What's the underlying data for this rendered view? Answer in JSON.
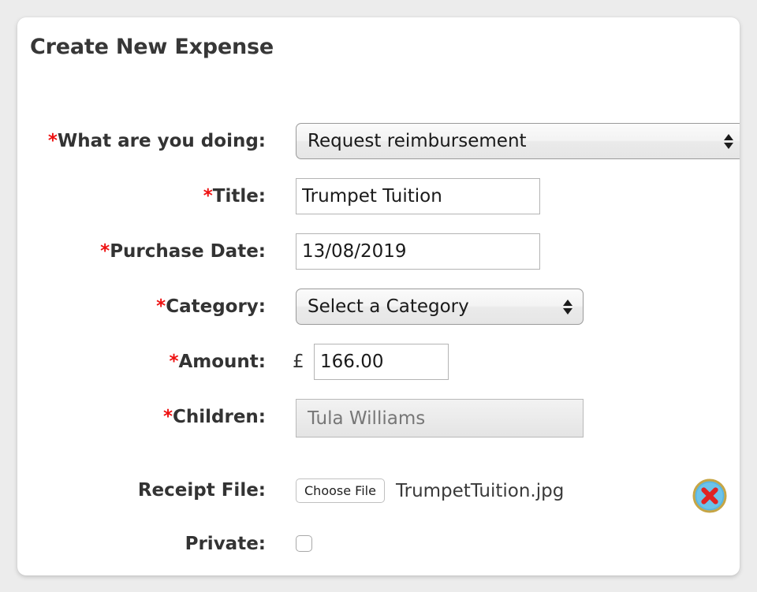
{
  "page": {
    "title": "Create New Expense",
    "background_color": "#ececec",
    "panel_color": "#ffffff",
    "required_marker": "*",
    "required_color": "#ee1111"
  },
  "form": {
    "rows": [
      {
        "name": "what-are-you-doing",
        "required": true,
        "label": "What are you doing:",
        "control": "select",
        "value": "Request reimbursement"
      },
      {
        "name": "title",
        "required": true,
        "label": "Title:",
        "control": "text",
        "value": "Trumpet Tuition"
      },
      {
        "name": "purchase-date",
        "required": true,
        "label": "Purchase Date:",
        "control": "text",
        "value": "13/08/2019"
      },
      {
        "name": "category",
        "required": true,
        "label": "Category:",
        "control": "select",
        "value": "Select a Category"
      },
      {
        "name": "amount",
        "required": true,
        "label": "Amount:",
        "control": "currency",
        "currency_symbol": "£",
        "value": "166.00"
      },
      {
        "name": "children",
        "required": true,
        "label": "Children:",
        "control": "disabled-text",
        "value": "Tula Williams"
      },
      {
        "name": "receipt-file",
        "required": false,
        "label": "Receipt File:",
        "control": "file",
        "button_label": "Choose File",
        "value": "TrumpetTuition.jpg",
        "delete_icon": "delete-circle-x-icon"
      },
      {
        "name": "private",
        "required": false,
        "label": "Private:",
        "control": "checkbox",
        "checked": false
      }
    ]
  },
  "icons": {
    "select_arrows": "sort-up-down-arrows-icon",
    "delete": "delete-circle-x-icon",
    "delete_colors": {
      "ring": "#c6a545",
      "circle": "#6cc3ea",
      "x": "#e02222"
    }
  }
}
